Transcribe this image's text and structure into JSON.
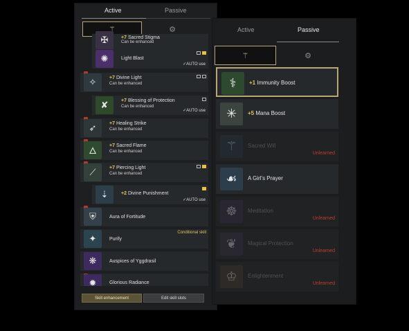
{
  "left_panel": {
    "tabs": [
      {
        "label": "Active"
      },
      {
        "label": "Passive"
      }
    ],
    "filters": [
      {
        "icon": "emblem-icon"
      },
      {
        "icon": "emblem-dim-icon"
      }
    ],
    "skills": [
      {
        "level": "+7",
        "name": "Sacred Stigma",
        "status": "Can be enhanced",
        "icon": "stigma-icon"
      },
      {
        "level": "",
        "name": "Light Blast",
        "status": "",
        "auto": "AUTO use",
        "icon": "light-blast-icon"
      },
      {
        "level": "+7",
        "name": "Divine Light",
        "status": "Can be enhanced",
        "icon": "divine-light-icon"
      },
      {
        "level": "+7",
        "name": "Blessing of Protection",
        "status": "Can be enhanced",
        "auto": "AUTO use",
        "icon": "blessing-icon"
      },
      {
        "level": "+7",
        "name": "Healing Strike",
        "status": "Can be enhanced",
        "icon": "healing-strike-icon"
      },
      {
        "level": "+7",
        "name": "Sacred Flame",
        "status": "Can be enhanced",
        "icon": "sacred-flame-icon"
      },
      {
        "level": "+7",
        "name": "Piercing Light",
        "status": "Can be enhanced",
        "icon": "piercing-light-icon"
      },
      {
        "level": "+2",
        "name": "Divine Punishment",
        "status": "",
        "auto": "AUTO use",
        "icon": "divine-punishment-icon"
      },
      {
        "level": "",
        "name": "Aura of Fortitude",
        "status": "",
        "icon": "aura-icon"
      },
      {
        "level": "",
        "name": "Purify",
        "status": "",
        "conditional": "Conditional skill",
        "icon": "purify-icon"
      },
      {
        "level": "",
        "name": "Auspices of Yggdrasil",
        "status": "",
        "icon": "yggdrasil-icon"
      },
      {
        "level": "",
        "name": "Glorious Radiance",
        "status": "",
        "icon": "radiance-icon"
      }
    ],
    "buttons": {
      "enhance": "Skill enhancement",
      "edit": "Edit skill slots"
    }
  },
  "right_panel": {
    "tabs": [
      {
        "label": "Active"
      },
      {
        "label": "Passive"
      }
    ],
    "filters": [
      {
        "icon": "emblem-icon"
      },
      {
        "icon": "emblem-dim-icon"
      }
    ],
    "skills": [
      {
        "level": "+1",
        "name": "Immunity Boost",
        "status": "",
        "icon": "immunity-icon"
      },
      {
        "level": "+5",
        "name": "Mana Boost",
        "status": "",
        "icon": "mana-icon"
      },
      {
        "level": "",
        "name": "Sacred Will",
        "status": "Unlearned",
        "icon": "sacred-will-icon"
      },
      {
        "level": "",
        "name": "A Girl's Prayer",
        "status": "",
        "icon": "prayer-icon"
      },
      {
        "level": "",
        "name": "Meditation",
        "status": "Unlearned",
        "icon": "meditation-icon"
      },
      {
        "level": "",
        "name": "Magical Protection",
        "status": "Unlearned",
        "icon": "magical-protection-icon"
      },
      {
        "level": "",
        "name": "Enlightenment",
        "status": "Unlearned",
        "icon": "enlightenment-icon"
      }
    ]
  },
  "colors": {
    "accent_gold": "#e6c263",
    "unlearned_red": "#c33a33",
    "selection_border": "#b9a777"
  }
}
